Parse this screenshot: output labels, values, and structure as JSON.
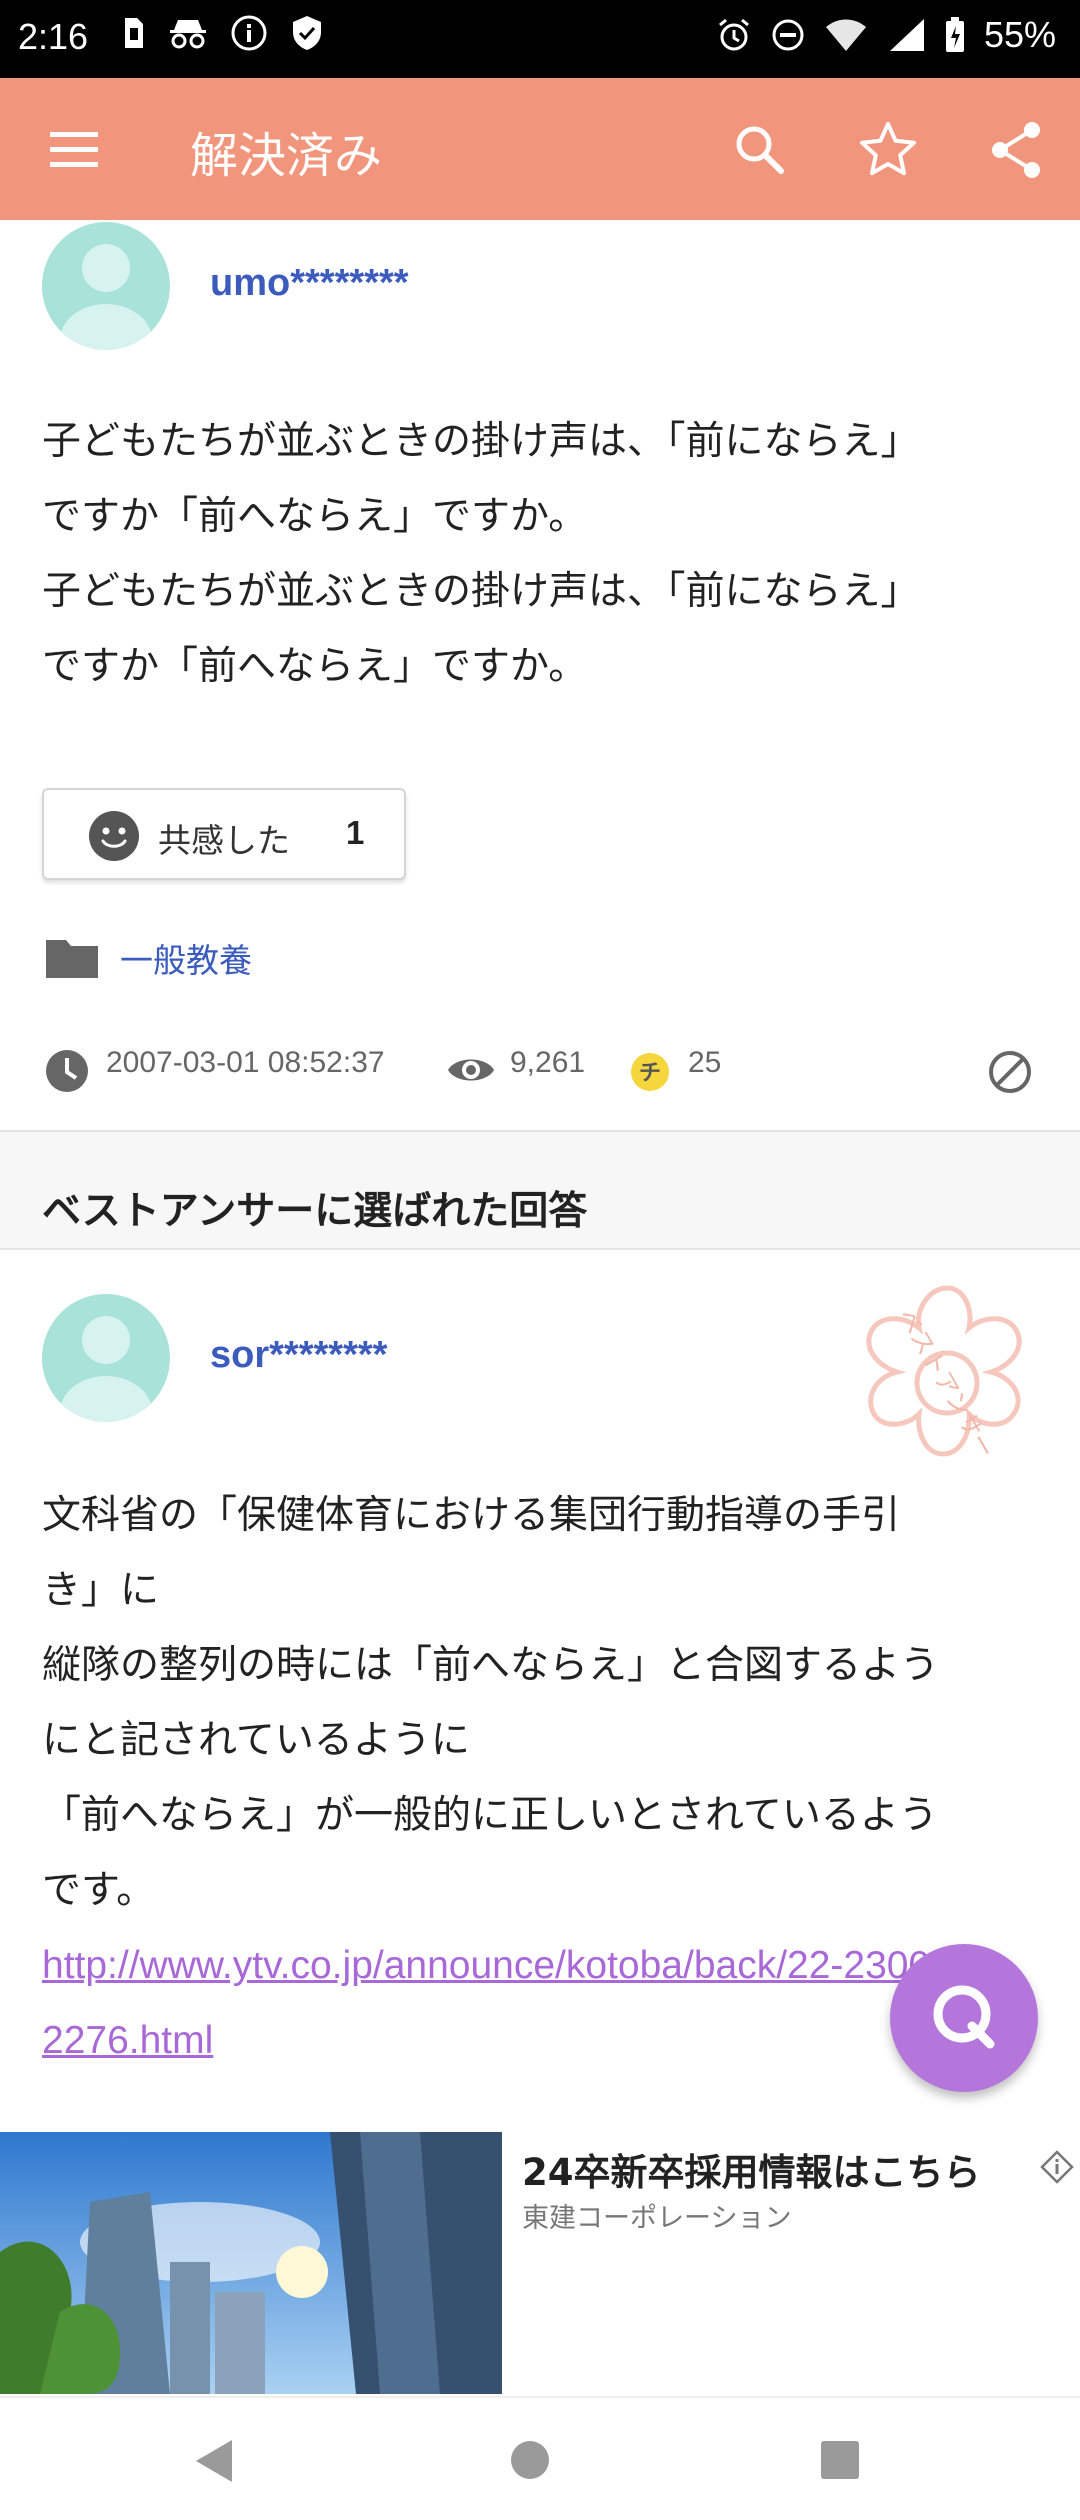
{
  "status_bar": {
    "time": "2:16",
    "battery": "55%"
  },
  "app_bar": {
    "title": "解決済み"
  },
  "question": {
    "username": "umo********",
    "body": "子どもたちが並ぶときの掛け声は、「前にならえ」\nですか「前へならえ」ですか。\n子どもたちが並ぶときの掛け声は、「前にならえ」\nですか「前へならえ」ですか。",
    "empathy_label": "共感した",
    "empathy_count": "1",
    "category": "一般教養",
    "date": "2007-03-01 08:52:37",
    "views": "9,261",
    "coins": "25"
  },
  "best_answer": {
    "heading": "ベストアンサーに選ばれた回答",
    "username": "sor********",
    "stamp_text": "ベストアンサー",
    "body": "文科省の「保健体育における集団行動指導の手引\nき」に\n縦隊の整列の時には「前へならえ」と合図するよう\nにと記されているように\n「前へならえ」が一般的に正しいとされているよう\nです。",
    "link": "http://www.ytv.co.jp/announce/kotoba/back/22-2300/2276.html"
  },
  "ad": {
    "title": "24卒新卒採用情報はこちら",
    "advertiser": "東建コーポレーション"
  },
  "colors": {
    "app_bar": "#f1967c",
    "link_blue": "#3b5bbd",
    "fab": "#b576dc",
    "avatar": "#a8e2d9"
  },
  "icons": {
    "menu": "menu-icon",
    "search": "search-icon",
    "favorite": "star-icon",
    "share": "share-icon",
    "fab": "q-icon"
  }
}
